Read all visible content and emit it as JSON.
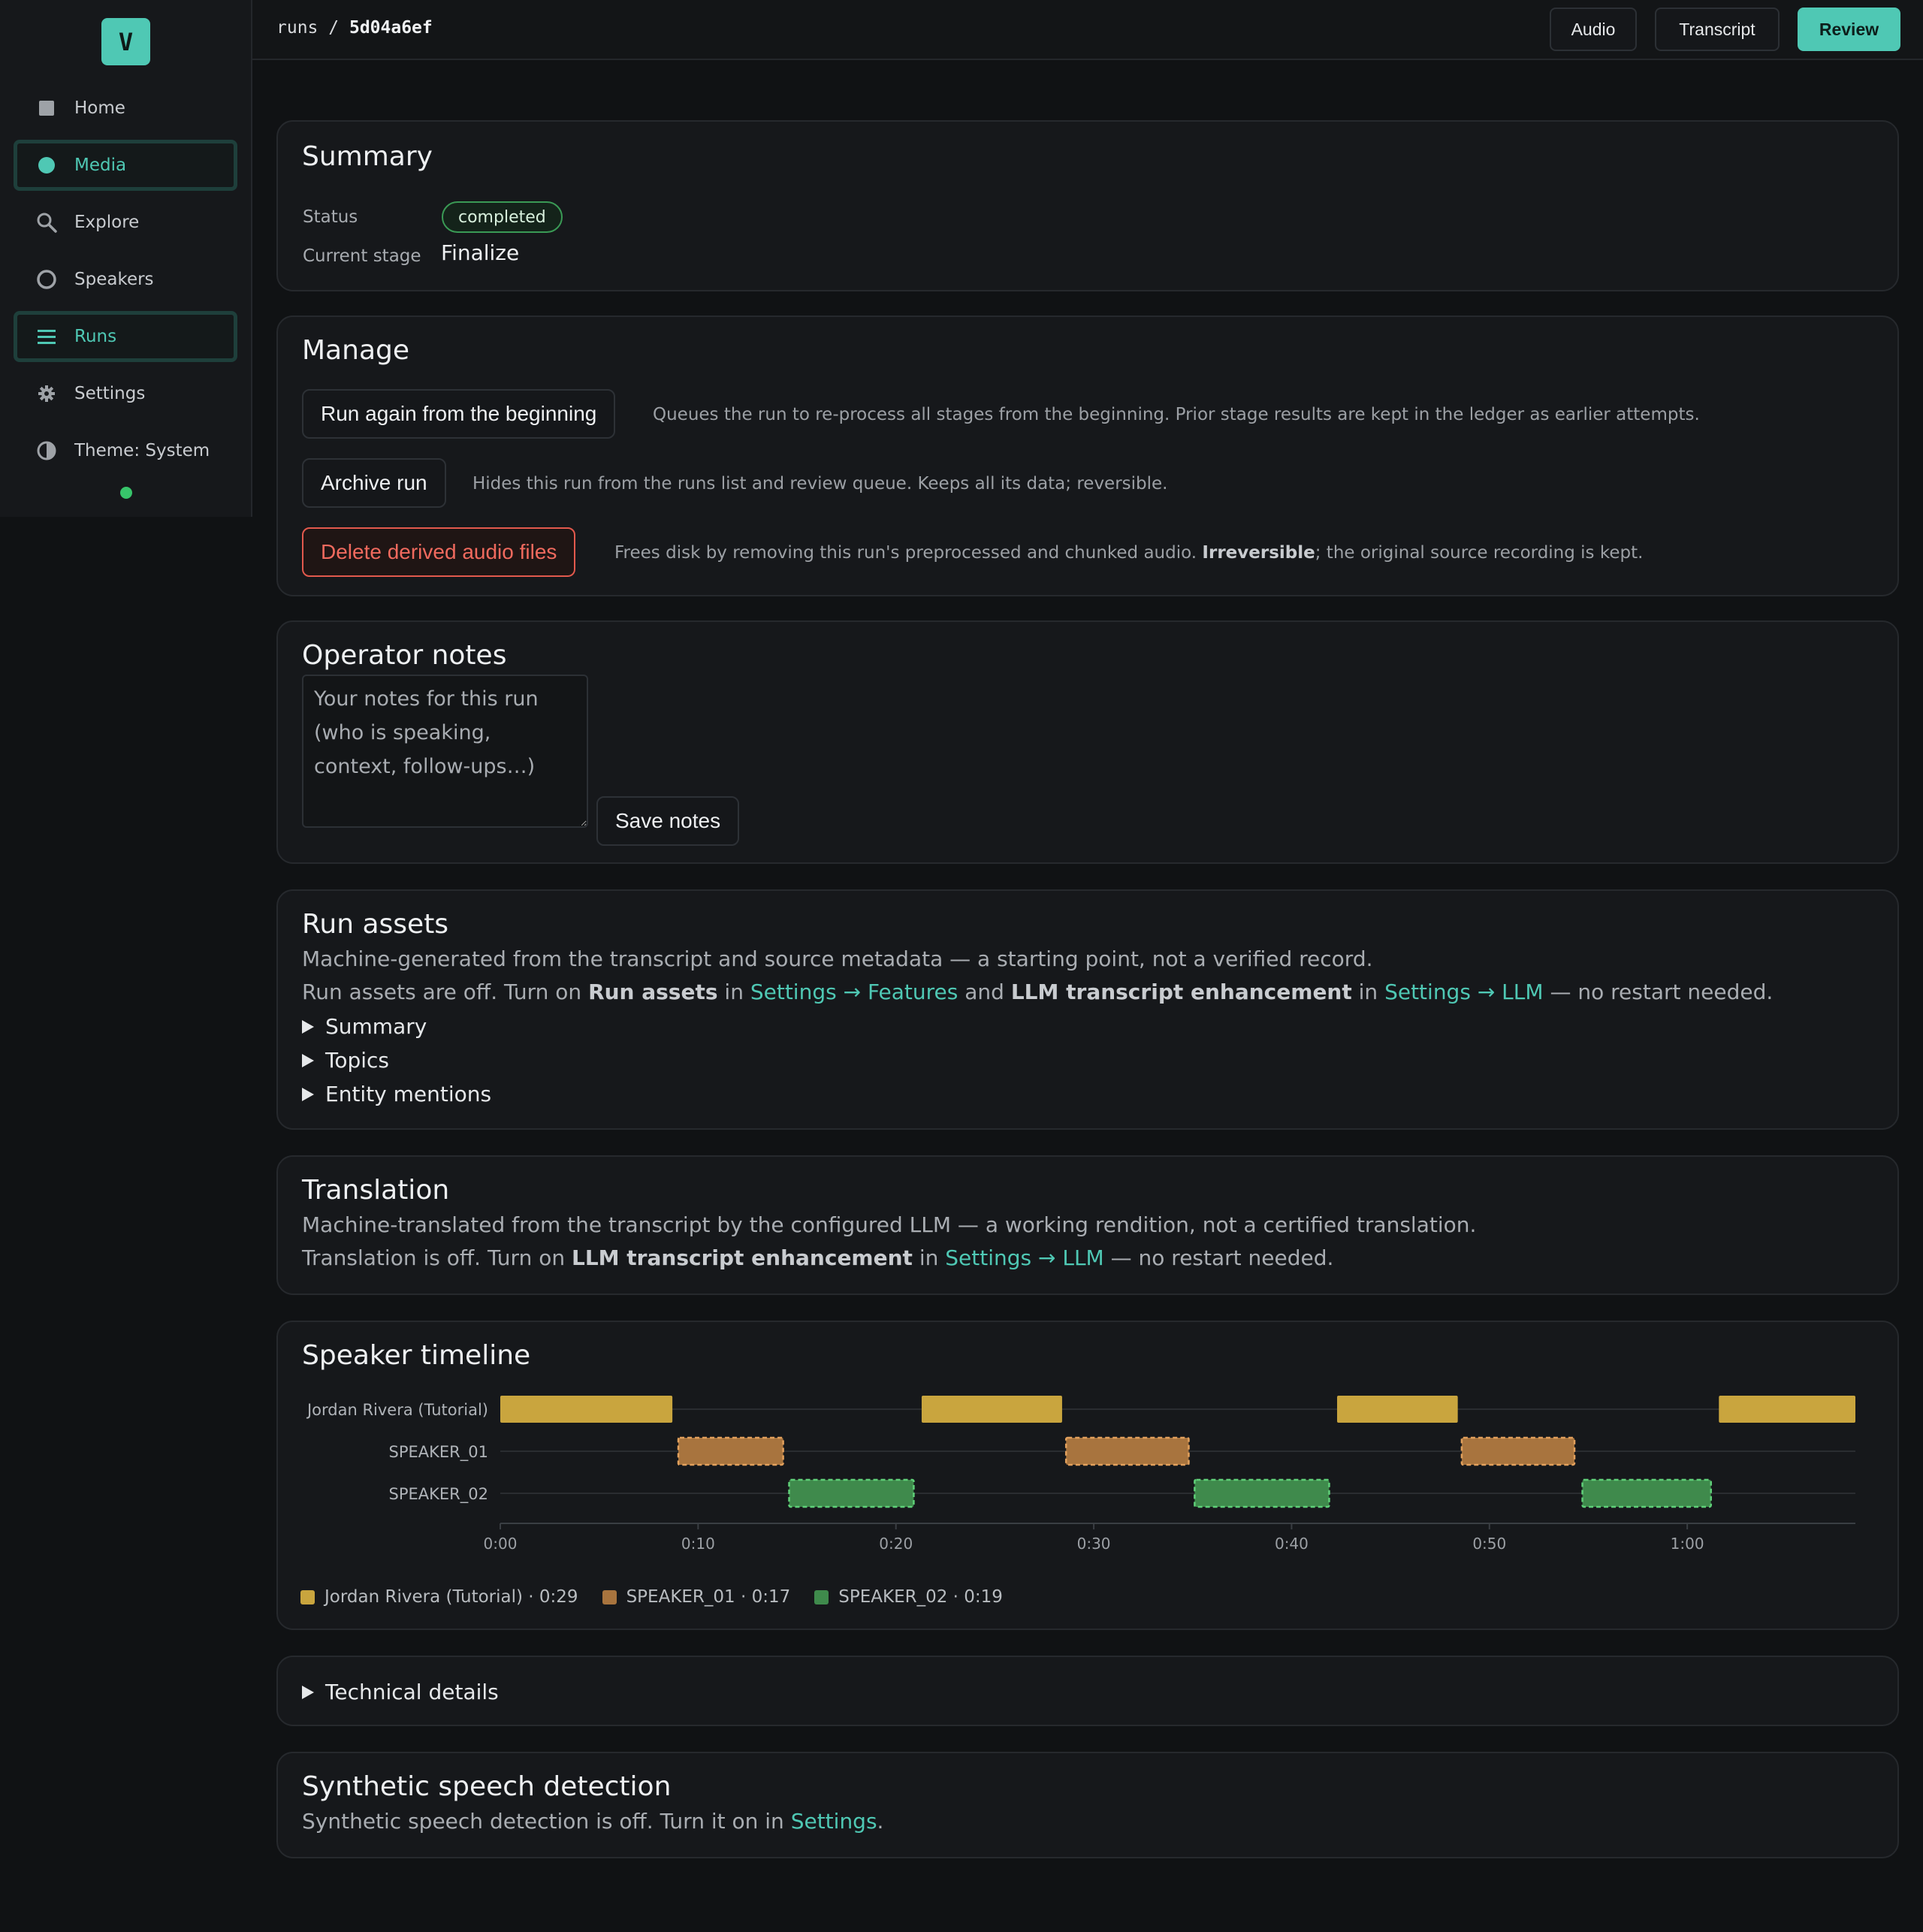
{
  "sidebar": {
    "logo": "V",
    "items": [
      {
        "label": "Home",
        "icon": "home-square-icon"
      },
      {
        "label": "Media",
        "icon": "media-dot-icon"
      },
      {
        "label": "Explore",
        "icon": "search-icon"
      },
      {
        "label": "Speakers",
        "icon": "speaker-ring-icon"
      },
      {
        "label": "Runs",
        "icon": "list-icon"
      },
      {
        "label": "Settings",
        "icon": "gear-icon"
      },
      {
        "label": "Theme: System",
        "icon": "contrast-icon"
      }
    ],
    "active_accent": "#4fc8b4",
    "status_color": "#37c46a"
  },
  "topbar": {
    "crumb_root": "runs",
    "crumb_sep": "/",
    "crumb_id": "5d04a6ef",
    "audio_label": "Audio",
    "transcript_label": "Transcript",
    "review_label": "Review"
  },
  "summary": {
    "title": "Summary",
    "status_label": "Status",
    "status_value": "completed",
    "stage_label": "Current stage",
    "stage_value": "Finalize"
  },
  "manage": {
    "title": "Manage",
    "rerun_label": "Run again from the beginning",
    "rerun_desc": "Queues the run to re-process all stages from the beginning. Prior stage results are kept in the ledger as earlier attempts.",
    "archive_label": "Archive run",
    "archive_desc": "Hides this run from the runs list and review queue. Keeps all its data; reversible.",
    "delete_label": "Delete derived audio files",
    "delete_desc_pre": "Frees disk by removing this run's preprocessed and chunked audio. ",
    "delete_desc_bold": "Irreversible",
    "delete_desc_post": "; the original source recording is kept."
  },
  "notes": {
    "title": "Operator notes",
    "placeholder": "Your notes for this run (who is speaking, context, follow-ups…)",
    "save_label": "Save notes"
  },
  "assets": {
    "title": "Run assets",
    "subtitle": "Machine-generated from the transcript and source metadata — a starting point, not a verified record.",
    "off_1": "Run assets are off. Turn on ",
    "off_b1": "Run assets",
    "off_2": " in ",
    "off_l1": "Settings → Features",
    "off_3": " and ",
    "off_b2": "LLM transcript enhancement",
    "off_4": " in ",
    "off_l2": "Settings → LLM",
    "off_5": " — no restart needed.",
    "sections": [
      "Summary",
      "Topics",
      "Entity mentions"
    ]
  },
  "translation": {
    "title": "Translation",
    "subtitle": "Machine-translated from the transcript by the configured LLM — a working rendition, not a certified translation.",
    "off_1": "Translation is off. Turn on ",
    "off_b1": "LLM transcript enhancement",
    "off_2": " in ",
    "off_l1": "Settings → LLM",
    "off_3": " — no restart needed."
  },
  "timeline": {
    "title": "Speaker timeline"
  },
  "chart_data": {
    "type": "bar",
    "subtype": "gantt-timeline",
    "x_unit": "seconds",
    "xlim": [
      0,
      68.5
    ],
    "ticks": [
      {
        "t": 0,
        "label": "0:00"
      },
      {
        "t": 10,
        "label": "0:10"
      },
      {
        "t": 20,
        "label": "0:20"
      },
      {
        "t": 30,
        "label": "0:30"
      },
      {
        "t": 40,
        "label": "0:40"
      },
      {
        "t": 50,
        "label": "0:50"
      },
      {
        "t": 60,
        "label": "1:00"
      }
    ],
    "series": [
      {
        "name": "Jordan Rivera (Tutorial)",
        "color": "#c9a53e",
        "style": "solid",
        "total": "0:29",
        "segments": [
          [
            0,
            8.7
          ],
          [
            21.3,
            28.4
          ],
          [
            42.3,
            48.4
          ],
          [
            61.6,
            68.5
          ]
        ]
      },
      {
        "name": "SPEAKER_01",
        "color": "#a8743e",
        "style": "dashed",
        "total": "0:17",
        "segments": [
          [
            9.0,
            14.3
          ],
          [
            28.6,
            34.8
          ],
          [
            48.6,
            54.3
          ]
        ]
      },
      {
        "name": "SPEAKER_02",
        "color": "#3f8a4c",
        "style": "dashed",
        "total": "0:19",
        "segments": [
          [
            14.6,
            20.9
          ],
          [
            35.1,
            41.9
          ],
          [
            54.7,
            61.2
          ]
        ]
      }
    ]
  },
  "technical": {
    "label": "Technical details"
  },
  "synthetic": {
    "title": "Synthetic speech detection",
    "text_pre": "Synthetic speech detection is off. Turn it on in ",
    "link": "Settings",
    "text_post": "."
  }
}
